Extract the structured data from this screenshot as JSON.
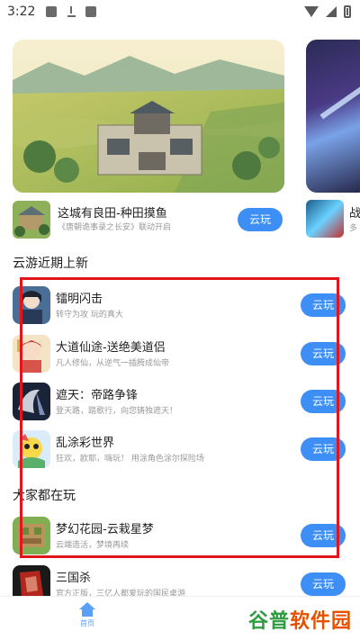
{
  "status_bar": {
    "time": "3:22",
    "icons": [
      "image-icon",
      "download-icon",
      "a-icon",
      "wifi-icon",
      "signal-icon",
      "battery-icon"
    ]
  },
  "banner": {
    "feature": {
      "title": "这城有良田-种田摸鱼",
      "subtitle": "《唐朝诡事录之长安》联动开启",
      "button": "云玩"
    },
    "peek": {
      "title": "战",
      "subtitle": "多"
    }
  },
  "sections": [
    {
      "title": "云游近期上新",
      "items": [
        {
          "title": "镭明闪击",
          "subtitle": "转守为攻 玩的真大",
          "button": "云玩"
        },
        {
          "title": "大道仙途-送绝美道侣",
          "subtitle": "凡人修仙，从逆气一插腾成仙帝",
          "button": "云玩"
        },
        {
          "title": "遮天：帝路争锋",
          "subtitle": "登天路，踏歌行，向您铸独遮天！",
          "button": "云玩"
        },
        {
          "title": "乱涂彩世界",
          "subtitle": "狂欢，欧耶，嗨玩！ 用涂角色涂尔探险场",
          "button": "云玩"
        }
      ]
    },
    {
      "title": "大家都在玩",
      "items": [
        {
          "title": "梦幻花园-云栽星梦",
          "subtitle": "云端造活，梦境再续",
          "button": "云玩"
        },
        {
          "title": "三国杀",
          "subtitle": "官方正版，三亿人都爱玩的国民桌游",
          "button": "云玩"
        }
      ]
    }
  ],
  "bottom_nav": {
    "home_label": "首页"
  },
  "watermark": {
    "text1": "谷普",
    "text2": "软件园"
  },
  "colors": {
    "accent": "#3d8ef5",
    "highlight": "#e2151c"
  }
}
